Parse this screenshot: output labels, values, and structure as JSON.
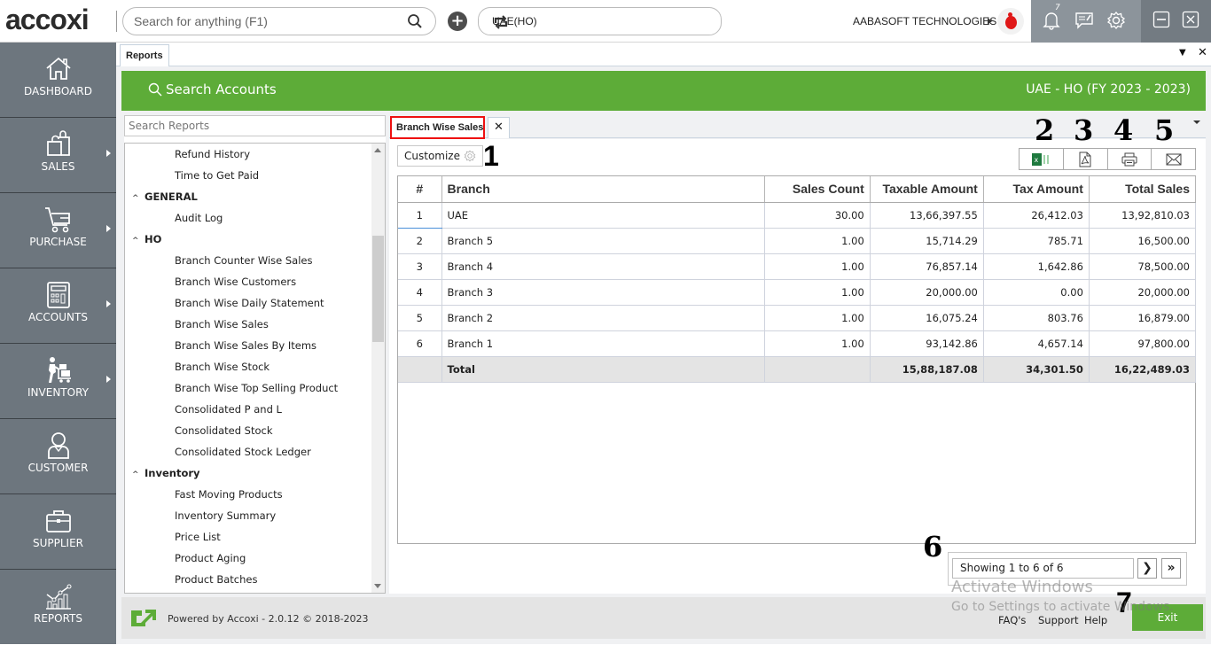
{
  "topbar": {
    "logo": "accoxi",
    "search_placeholder": "Search for anything (F1)",
    "branch_selected": "UAE(HO)",
    "company": "AABASOFT TECHNOLOGIES",
    "notification_count": "7"
  },
  "sidebar": {
    "items": [
      {
        "label": "DASHBOARD",
        "icon": "home-icon",
        "has_submenu": false
      },
      {
        "label": "SALES",
        "icon": "shopping-bag-icon",
        "has_submenu": true
      },
      {
        "label": "PURCHASE",
        "icon": "cart-icon",
        "has_submenu": true
      },
      {
        "label": "ACCOUNTS",
        "icon": "calculator-icon",
        "has_submenu": true
      },
      {
        "label": "INVENTORY",
        "icon": "inventory-icon",
        "has_submenu": true
      },
      {
        "label": "CUSTOMER",
        "icon": "user-icon",
        "has_submenu": false
      },
      {
        "label": "SUPPLIER",
        "icon": "briefcase-icon",
        "has_submenu": false
      },
      {
        "label": "REPORTS",
        "icon": "chart-icon",
        "has_submenu": false
      }
    ]
  },
  "tabs": {
    "main_tab": "Reports"
  },
  "header": {
    "search_accounts": "Search Accounts",
    "fiscal_year": "UAE - HO (FY 2023 - 2023)"
  },
  "reports_panel": {
    "search_placeholder": "Search Reports",
    "tree": [
      {
        "type": "item",
        "label": "Refund History"
      },
      {
        "type": "item",
        "label": "Time to Get Paid"
      },
      {
        "type": "group",
        "label": "GENERAL"
      },
      {
        "type": "item",
        "label": "Audit Log"
      },
      {
        "type": "group",
        "label": "HO"
      },
      {
        "type": "item",
        "label": "Branch Counter Wise Sales"
      },
      {
        "type": "item",
        "label": "Branch Wise Customers"
      },
      {
        "type": "item",
        "label": "Branch Wise Daily Statement"
      },
      {
        "type": "item",
        "label": "Branch Wise Sales"
      },
      {
        "type": "item",
        "label": "Branch Wise Sales By Items"
      },
      {
        "type": "item",
        "label": "Branch Wise Stock"
      },
      {
        "type": "item",
        "label": "Branch Wise Top Selling Product"
      },
      {
        "type": "item",
        "label": "Consolidated P and L"
      },
      {
        "type": "item",
        "label": "Consolidated Stock"
      },
      {
        "type": "item",
        "label": "Consolidated Stock Ledger"
      },
      {
        "type": "group",
        "label": "Inventory"
      },
      {
        "type": "item",
        "label": "Fast Moving Products"
      },
      {
        "type": "item",
        "label": "Inventory Summary"
      },
      {
        "type": "item",
        "label": "Price List"
      },
      {
        "type": "item",
        "label": "Product Aging"
      },
      {
        "type": "item",
        "label": "Product Batches"
      }
    ]
  },
  "report": {
    "tab_label": "Branch Wise Sales",
    "customize_label": "Customize",
    "export_buttons": [
      "excel-icon",
      "pdf-icon",
      "print-icon",
      "email-icon"
    ],
    "columns": [
      "#",
      "Branch",
      "Sales Count",
      "Taxable Amount",
      "Tax Amount",
      "Total Sales"
    ],
    "rows": [
      [
        "1",
        "UAE",
        "30.00",
        "13,66,397.55",
        "26,412.03",
        "13,92,810.03"
      ],
      [
        "2",
        "Branch 5",
        "1.00",
        "15,714.29",
        "785.71",
        "16,500.00"
      ],
      [
        "3",
        "Branch 4",
        "1.00",
        "76,857.14",
        "1,642.86",
        "78,500.00"
      ],
      [
        "4",
        "Branch 3",
        "1.00",
        "20,000.00",
        "0.00",
        "20,000.00"
      ],
      [
        "5",
        "Branch 2",
        "1.00",
        "16,075.24",
        "803.76",
        "16,879.00"
      ],
      [
        "6",
        "Branch 1",
        "1.00",
        "93,142.86",
        "4,657.14",
        "97,800.00"
      ]
    ],
    "total_row": [
      "",
      "Total",
      "",
      "15,88,187.08",
      "34,301.50",
      "16,22,489.03"
    ],
    "pager_info": "Showing 1 to 6 of 6"
  },
  "annotations": [
    "1",
    "2",
    "3",
    "4",
    "5",
    "6",
    "7"
  ],
  "footer": {
    "powered": "Powered by Accoxi - 2.0.12 © 2018-2023",
    "links": [
      "FAQ's",
      "Support",
      "Help"
    ],
    "exit_label": "Exit"
  },
  "watermark": {
    "line1": "Activate Windows",
    "line2": "Go to Settings to activate Windows."
  },
  "colors": {
    "accent_green": "#5dac38",
    "sidebar": "#6d767e",
    "highlight_red": "#e11111"
  }
}
